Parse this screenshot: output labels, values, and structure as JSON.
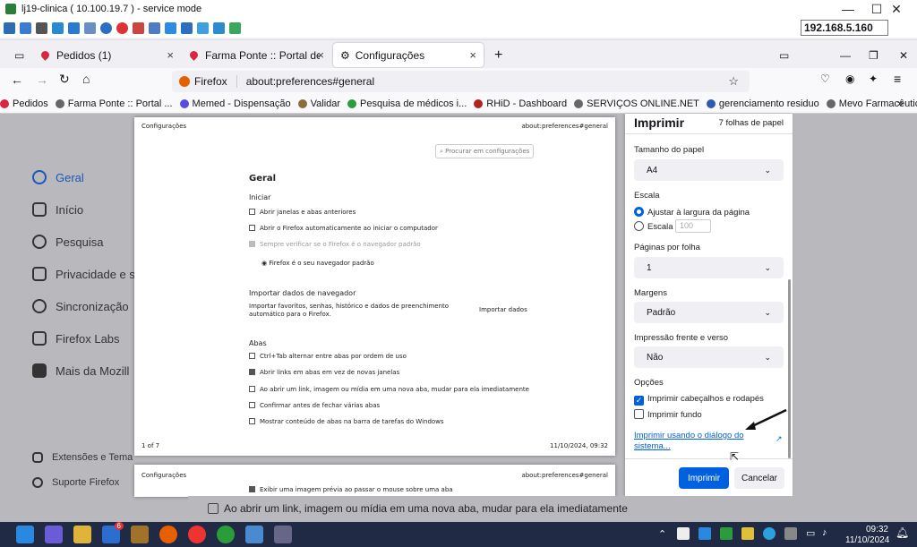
{
  "remote": {
    "title": "lj19-clinica ( 10.100.19.7 ) - service mode",
    "ip": "192.168.5.160"
  },
  "tabs": [
    {
      "label": "Pedidos (1)",
      "close": "×"
    },
    {
      "label": "Farma Ponte :: Portal de Serviço",
      "close": "×"
    },
    {
      "label": "Configurações",
      "close": "×"
    }
  ],
  "new_tab": "+",
  "url": {
    "identity": "Firefox",
    "address": "about:preferences#general"
  },
  "bookmarks": [
    {
      "label": "Pedidos",
      "color": "#d7263d"
    },
    {
      "label": "Farma Ponte :: Portal ...",
      "color": "#666"
    },
    {
      "label": "Memed - Dispensação",
      "color": "#5b4bdb"
    },
    {
      "label": "Validar",
      "color": "#8a6d3b"
    },
    {
      "label": "Pesquisa de médicos i...",
      "color": "#2a9d3a"
    },
    {
      "label": "RHiD - Dashboard",
      "color": "#b0241c"
    },
    {
      "label": "SERVIÇOS ONLINE.NET",
      "color": "#666"
    },
    {
      "label": "gerenciamento residuo",
      "color": "#2a5db0"
    },
    {
      "label": "Mevo Farmacêuticos -...",
      "color": "#666"
    }
  ],
  "sidebar": [
    {
      "label": "Geral",
      "active": true
    },
    {
      "label": "Início"
    },
    {
      "label": "Pesquisa"
    },
    {
      "label": "Privacidade e s"
    },
    {
      "label": "Sincronização"
    },
    {
      "label": "Firefox Labs"
    },
    {
      "label": "Mais da Mozill"
    }
  ],
  "sidebar_footer": [
    "Extensões e Tema",
    "Suporte Firefox"
  ],
  "preview": {
    "header_left": "Configurações",
    "header_right": "about:preferences#general",
    "search_placeholder": "Procurar em configurações",
    "heading": "Geral",
    "sec_start": "Iniciar",
    "opt1": "Abrir janelas e abas anteriores",
    "opt2": "Abrir o Firefox automaticamente ao iniciar o computador",
    "opt3": "Sempre verificar se o Firefox é o navegador padrão",
    "default_msg": "Firefox é o seu navegador padrão",
    "import_title": "Importar dados de navegador",
    "import_desc": "Importar favoritos, senhas, histórico e dados de preenchimento automático para o Firefox.",
    "import_btn": "Importar dados",
    "tabs_title": "Abas",
    "tabopt1": "Ctrl+Tab alternar entre abas por ordem de uso",
    "tabopt2": "Abrir links em abas em vez de novas janelas",
    "tabopt3": "Ao abrir um link, imagem ou mídia em uma nova aba, mudar para ela imediatamente",
    "tabopt4": "Confirmar antes de fechar várias abas",
    "tabopt5": "Mostrar conteúdo de abas na barra de tarefas do Windows",
    "footer_left": "1 of 7",
    "footer_right": "11/10/2024, 09:32",
    "page2_opt": "Exibir uma imagem prévia ao passar o mouse sobre uma aba"
  },
  "print": {
    "title": "Imprimir",
    "sheets": "7 folhas de papel",
    "paper_label": "Tamanho do papel",
    "paper_value": "A4",
    "scale_label": "Escala",
    "fit_label": "Ajustar à largura da página",
    "scale_opt": "Escala",
    "scale_value": "100",
    "pps_label": "Páginas por folha",
    "pps_value": "1",
    "margins_label": "Margens",
    "margins_value": "Padrão",
    "duplex_label": "Impressão frente e verso",
    "duplex_value": "Não",
    "options_label": "Opções",
    "headers_label": "Imprimir cabeçalhos e rodapés",
    "bg_label": "Imprimir fundo",
    "system_dialog": "Imprimir usando o diálogo do sistema...",
    "print_btn": "Imprimir",
    "cancel_btn": "Cancelar"
  },
  "behind_text": "Ao abrir um link, imagem ou mídia em uma nova aba, mudar para ela imediatamente",
  "taskbar": {
    "time": "09:32",
    "date": "11/10/2024",
    "badge": "6"
  }
}
